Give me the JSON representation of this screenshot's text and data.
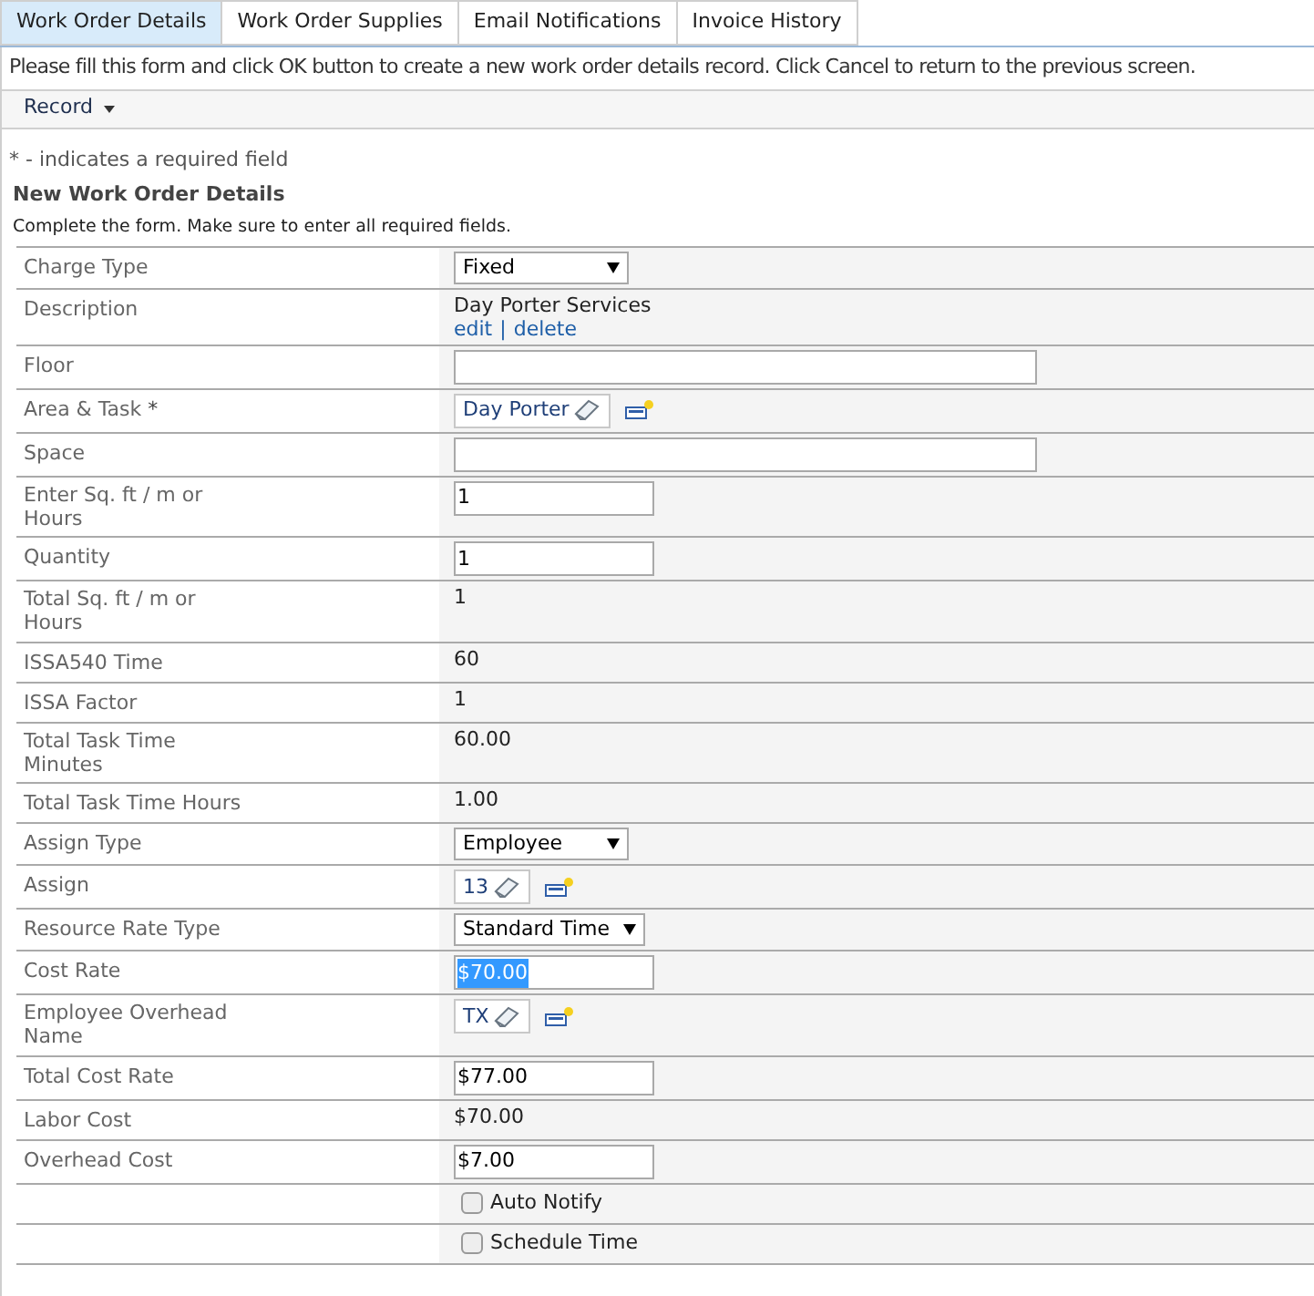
{
  "tabs": [
    {
      "label": "Work Order Details",
      "selected": true
    },
    {
      "label": "Work Order Supplies",
      "selected": false
    },
    {
      "label": "Email Notifications",
      "selected": false
    },
    {
      "label": "Invoice History",
      "selected": false
    }
  ],
  "instructions": "Please fill this form and click OK button to create a new work order details record. Click Cancel to return to the previous screen.",
  "toolbar": {
    "menu": "Record"
  },
  "required_note": "* - indicates a required field",
  "form": {
    "title": "New Work Order Details",
    "subtitle": "Complete the form. Make sure to enter all required fields.",
    "rows": [
      {
        "label": "Charge Type",
        "kind": "select",
        "value": "Fixed"
      },
      {
        "label": "Description",
        "kind": "text",
        "value": "Day Porter Services",
        "links": [
          "edit",
          "delete"
        ],
        "separator": "|"
      },
      {
        "label": "Floor",
        "kind": "wide_input",
        "value": ""
      },
      {
        "label": "Area & Task",
        "required_mark": "*",
        "kind": "lookup",
        "value": "Day Porter"
      },
      {
        "label": "Space",
        "kind": "wide_input",
        "value": ""
      },
      {
        "label": "Enter Sq. ft / m or Hours",
        "kind": "input",
        "value": "1"
      },
      {
        "label": "Quantity",
        "kind": "input",
        "value": "1"
      },
      {
        "label": "Total Sq. ft / m or Hours",
        "kind": "text",
        "value": "1"
      },
      {
        "label": "ISSA540 Time",
        "kind": "text",
        "value": "60"
      },
      {
        "label": "ISSA Factor",
        "kind": "text",
        "value": "1"
      },
      {
        "label": "Total Task Time Minutes",
        "kind": "text",
        "value": "60.00"
      },
      {
        "label": "Total Task Time Hours",
        "kind": "text",
        "value": "1.00"
      },
      {
        "label": "Assign Type",
        "kind": "select",
        "value": "Employee"
      },
      {
        "label": "Assign",
        "kind": "lookup",
        "value": "13"
      },
      {
        "label": "Resource Rate Type",
        "kind": "select",
        "value": "Standard Time"
      },
      {
        "label": "Cost Rate",
        "kind": "input",
        "value": "$70.00",
        "text_selected": true
      },
      {
        "label": "Employee Overhead Name",
        "kind": "lookup",
        "value": "TX"
      },
      {
        "label": "Total Cost Rate",
        "kind": "input",
        "value": "$77.00"
      },
      {
        "label": "Labor Cost",
        "kind": "text",
        "value": "$70.00"
      },
      {
        "label": "Overhead Cost",
        "kind": "input",
        "value": "$7.00"
      },
      {
        "kind": "checkbox",
        "value": "Auto Notify",
        "checked": false
      },
      {
        "kind": "checkbox",
        "value": "Schedule Time",
        "checked": false
      }
    ]
  }
}
